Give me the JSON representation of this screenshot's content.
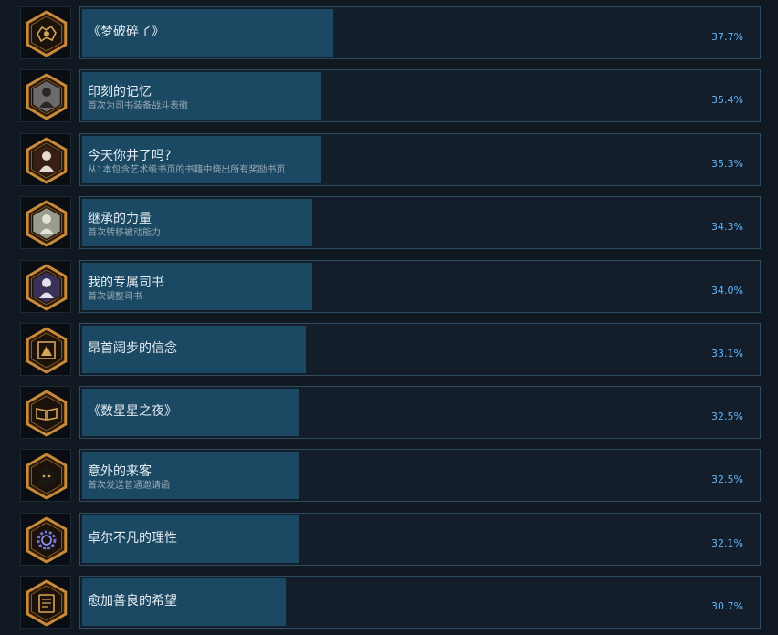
{
  "achievements": [
    {
      "title": "《梦破碎了》",
      "desc": "",
      "percent": "37.7%",
      "fill": 0.371,
      "icon": "dream-shatter-icon"
    },
    {
      "title": "印刻的记忆",
      "desc": "首次为司书装备战斗表徵",
      "percent": "35.4%",
      "fill": 0.352,
      "icon": "portrait-memory-icon"
    },
    {
      "title": "今天你井了吗?",
      "desc": "从1本包含艺术级书页的书籍中烧出所有奖励书页",
      "percent": "35.3%",
      "fill": 0.352,
      "icon": "portrait-dark-figure-icon"
    },
    {
      "title": "继承的力量",
      "desc": "首次转移被动能力",
      "percent": "34.3%",
      "fill": 0.34,
      "icon": "portrait-pale-figure-icon"
    },
    {
      "title": "我的专属司书",
      "desc": "首次调整司书",
      "percent": "34.0%",
      "fill": 0.34,
      "icon": "portrait-librarian-icon"
    },
    {
      "title": "昂首阔步的信念",
      "desc": "",
      "percent": "33.1%",
      "fill": 0.33,
      "icon": "frame-emblem-icon"
    },
    {
      "title": "《数星星之夜》",
      "desc": "",
      "percent": "32.5%",
      "fill": 0.32,
      "icon": "open-book-icon"
    },
    {
      "title": "意外的来客",
      "desc": "首次发送普通邀请函",
      "percent": "32.5%",
      "fill": 0.32,
      "icon": "hooded-guest-icon"
    },
    {
      "title": "卓尔不凡的理性",
      "desc": "",
      "percent": "32.1%",
      "fill": 0.32,
      "icon": "gear-icon"
    },
    {
      "title": "愈加善良的希望",
      "desc": "",
      "percent": "30.7%",
      "fill": 0.3,
      "icon": "scroll-page-icon"
    }
  ],
  "colors": {
    "background": "#101822",
    "bar_fill": "#1b4863",
    "bar_border": "#2e4d62",
    "percent_text": "#5fb8ff",
    "icon_gold": "#c98a3a"
  }
}
